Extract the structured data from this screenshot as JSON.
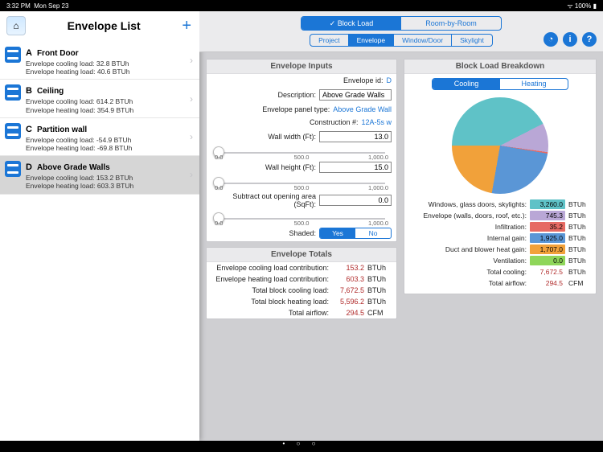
{
  "status": {
    "time": "3:32 PM",
    "date": "Mon Sep 23",
    "battery": "100%"
  },
  "sidebar": {
    "title": "Envelope List",
    "items": [
      {
        "letter": "A",
        "name": "Front Door",
        "cooling": "Envelope cooling load: 32.8 BTUh",
        "heating": "Envelope heating load: 40.6 BTUh"
      },
      {
        "letter": "B",
        "name": "Ceiling",
        "cooling": "Envelope cooling load: 614.2 BTUh",
        "heating": "Envelope heating load: 354.9 BTUh"
      },
      {
        "letter": "C",
        "name": "Partition wall",
        "cooling": "Envelope cooling load: -54.9 BTUh",
        "heating": "Envelope heating load: -69.8 BTUh"
      },
      {
        "letter": "D",
        "name": "Above Grade Walls",
        "cooling": "Envelope cooling load: 153.2 BTUh",
        "heating": "Envelope heating load: 603.3 BTUh"
      }
    ],
    "selected": 3
  },
  "modes": {
    "a": "Block Load",
    "b": "Room-by-Room",
    "active": 0,
    "check": "✓"
  },
  "tabs": {
    "items": [
      "Project",
      "Envelope",
      "Window/Door",
      "Skylight"
    ],
    "active": 1
  },
  "inputs": {
    "title": "Envelope Inputs",
    "id_label": "Envelope id:",
    "id_value": "D",
    "desc_label": "Description:",
    "desc_value": "Above Grade Walls",
    "type_label": "Envelope panel type:",
    "type_value": "Above Grade Wall",
    "con_label": "Construction #:",
    "con_value": "12A-5s w",
    "width_label": "Wall width (Ft):",
    "width_value": "13.0",
    "height_label": "Wall height (Ft):",
    "height_value": "15.0",
    "open_label": "Subtract out opening area (SqFt):",
    "open_value": "0.0",
    "shaded_label": "Shaded:",
    "yes": "Yes",
    "no": "No",
    "ticks": {
      "a": "0.0",
      "b": "500.0",
      "c": "1,000.0"
    }
  },
  "totals": {
    "title": "Envelope Totals",
    "rows": [
      {
        "lab": "Envelope cooling load contribution:",
        "num": "153.2",
        "unit": "BTUh"
      },
      {
        "lab": "Envelope heating load contribution:",
        "num": "603.3",
        "unit": "BTUh"
      },
      {
        "lab": "Total block cooling load:",
        "num": "7,672.5",
        "unit": "BTUh"
      },
      {
        "lab": "Total block heating load:",
        "num": "5,596.2",
        "unit": "BTUh"
      },
      {
        "lab": "Total airflow:",
        "num": "294.5",
        "unit": "CFM"
      }
    ]
  },
  "breakdown": {
    "title": "Block Load Breakdown",
    "seg": {
      "a": "Cooling",
      "b": "Heating",
      "active": 0
    },
    "legend": [
      {
        "lab": "Windows, glass doors, skylights:",
        "val": "3,260.0",
        "unit": "BTUh",
        "color": "#5fc2c7"
      },
      {
        "lab": "Envelope (walls, doors, roof, etc.):",
        "val": "745.3",
        "unit": "BTUh",
        "color": "#b9a7d6"
      },
      {
        "lab": "Infiltration:",
        "val": "35.2",
        "unit": "BTUh",
        "color": "#e66a63"
      },
      {
        "lab": "Internal gain:",
        "val": "1,925.0",
        "unit": "BTUh",
        "color": "#5a96d6"
      },
      {
        "lab": "Duct and blower heat gain:",
        "val": "1,707.0",
        "unit": "BTUh",
        "color": "#f1a13a"
      },
      {
        "lab": "Ventilation:",
        "val": "0.0",
        "unit": "BTUh",
        "color": "#8fd65a"
      }
    ],
    "summary": [
      {
        "lab": "Total cooling:",
        "val": "7,672.5",
        "unit": "BTUh"
      },
      {
        "lab": "Total airflow:",
        "val": "294.5",
        "unit": "CFM"
      }
    ]
  },
  "chart_data": {
    "type": "pie",
    "title": "Block Load Breakdown — Cooling",
    "series": [
      {
        "name": "Windows, glass doors, skylights",
        "value": 3260.0,
        "color": "#5fc2c7"
      },
      {
        "name": "Envelope (walls, doors, roof, etc.)",
        "value": 745.3,
        "color": "#b9a7d6"
      },
      {
        "name": "Infiltration",
        "value": 35.2,
        "color": "#e66a63"
      },
      {
        "name": "Internal gain",
        "value": 1925.0,
        "color": "#5a96d6"
      },
      {
        "name": "Duct and blower heat gain",
        "value": 1707.0,
        "color": "#f1a13a"
      },
      {
        "name": "Ventilation",
        "value": 0.0,
        "color": "#8fd65a"
      }
    ],
    "total": 7672.5,
    "unit": "BTUh"
  }
}
